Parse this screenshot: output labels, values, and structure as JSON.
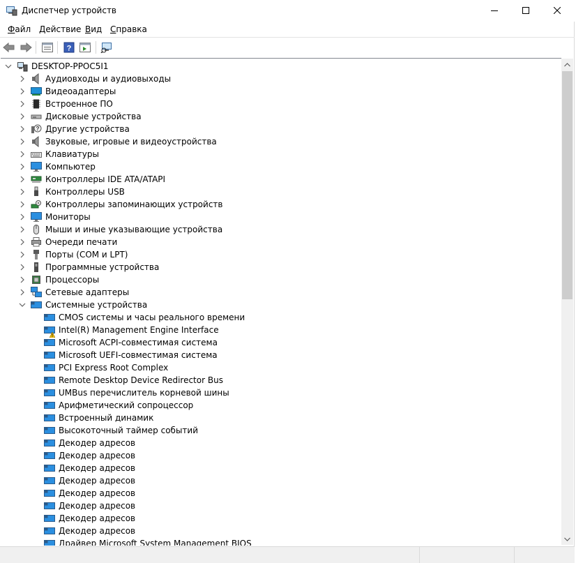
{
  "window": {
    "title": "Диспетчер устройств",
    "controls": {
      "minimize": "—",
      "maximize": "☐",
      "close": "✕"
    }
  },
  "menu": [
    {
      "label": "Файл",
      "underline_first": true
    },
    {
      "label": "Действие",
      "underline_first": true
    },
    {
      "label": "Вид",
      "underline_first": true
    },
    {
      "label": "Справка",
      "underline_first": true
    }
  ],
  "toolbar": {
    "buttons": [
      "back-icon",
      "forward-icon",
      "properties-icon",
      "help-icon",
      "update-driver-icon",
      "scan-hardware-icon"
    ]
  },
  "tree": {
    "root": {
      "label": "DESKTOP-PPOC5I1",
      "icon": "computer-icon",
      "expanded": true
    },
    "categories": [
      {
        "label": "Аудиовходы и аудиовыходы",
        "icon": "speaker-icon"
      },
      {
        "label": "Видеоадаптеры",
        "icon": "display-adapter-icon"
      },
      {
        "label": "Встроенное ПО",
        "icon": "firmware-icon"
      },
      {
        "label": "Дисковые устройства",
        "icon": "disk-drive-icon"
      },
      {
        "label": "Другие устройства",
        "icon": "unknown-device-icon"
      },
      {
        "label": "Звуковые, игровые и видеоустройства",
        "icon": "speaker-icon"
      },
      {
        "label": "Клавиатуры",
        "icon": "keyboard-icon"
      },
      {
        "label": "Компьютер",
        "icon": "monitor-icon"
      },
      {
        "label": "Контроллеры IDE ATA/ATAPI",
        "icon": "ide-controller-icon"
      },
      {
        "label": "Контроллеры USB",
        "icon": "usb-icon"
      },
      {
        "label": "Контроллеры запоминающих устройств",
        "icon": "storage-controller-icon"
      },
      {
        "label": "Мониторы",
        "icon": "monitor-icon"
      },
      {
        "label": "Мыши и иные указывающие устройства",
        "icon": "mouse-icon"
      },
      {
        "label": "Очереди печати",
        "icon": "printer-icon"
      },
      {
        "label": "Порты (COM и LPT)",
        "icon": "port-icon"
      },
      {
        "label": "Программные устройства",
        "icon": "software-device-icon"
      },
      {
        "label": "Процессоры",
        "icon": "processor-icon"
      },
      {
        "label": "Сетевые адаптеры",
        "icon": "network-adapter-icon"
      },
      {
        "label": "Системные устройства",
        "icon": "system-device-icon",
        "expanded": true
      }
    ],
    "system_devices": [
      {
        "label": "CMOS системы и часы реального времени",
        "warning": false
      },
      {
        "label": "Intel(R) Management Engine Interface",
        "warning": true
      },
      {
        "label": "Microsoft ACPI-совместимая система",
        "warning": false
      },
      {
        "label": "Microsoft UEFI-совместимая система",
        "warning": false
      },
      {
        "label": "PCI Express Root Complex",
        "warning": false
      },
      {
        "label": "Remote Desktop Device Redirector Bus",
        "warning": false
      },
      {
        "label": "UMBus перечислитель корневой шины",
        "warning": false
      },
      {
        "label": "Арифметический сопроцессор",
        "warning": false
      },
      {
        "label": "Встроенный динамик",
        "warning": false
      },
      {
        "label": "Высокоточный таймер событий",
        "warning": false
      },
      {
        "label": "Декодер адресов",
        "warning": false
      },
      {
        "label": "Декодер адресов",
        "warning": false
      },
      {
        "label": "Декодер адресов",
        "warning": false
      },
      {
        "label": "Декодер адресов",
        "warning": false
      },
      {
        "label": "Декодер адресов",
        "warning": false
      },
      {
        "label": "Декодер адресов",
        "warning": false
      },
      {
        "label": "Декодер адресов",
        "warning": false
      },
      {
        "label": "Декодер адресов",
        "warning": false
      },
      {
        "label": "Драйвер Microsoft System Management BIOS",
        "warning": false
      }
    ]
  },
  "colors": {
    "accent": "#0078d7",
    "warning": "#f4c20d",
    "chevron": "#606060"
  }
}
